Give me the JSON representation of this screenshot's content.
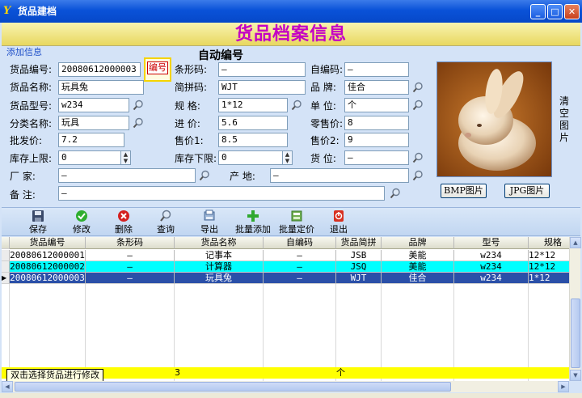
{
  "window": {
    "title": "货品建档",
    "icon": "app-icon"
  },
  "banner": {
    "title": "货品档案信息"
  },
  "section": {
    "add_info": "添加信息",
    "auto_code_label": "自动编号"
  },
  "form": {
    "code_label": "货品编号:",
    "code_value": "20080612000003",
    "code_button": "编号",
    "barcode_label": "条形码:",
    "barcode_value": "—",
    "selfcode_label": "自编码:",
    "selfcode_value": "—",
    "name_label": "货品名称:",
    "name_value": "玩具兔",
    "pinyin_label": "简拼码:",
    "pinyin_value": "WJT",
    "brand_label": "品  牌:",
    "brand_value": "佳合",
    "model_label": "货品型号:",
    "model_value": "w234",
    "spec_label": "规  格:",
    "spec_value": "1*12",
    "unit_label": "单  位:",
    "unit_value": "个",
    "category_label": "分类名称:",
    "category_value": "玩具",
    "purchase_label": "进  价:",
    "purchase_value": "5.6",
    "retail_label": "零售价:",
    "retail_value": "8",
    "wholesale_label": "批发价:",
    "wholesale_value": "7.2",
    "sale1_label": "售价1:",
    "sale1_value": "8.5",
    "sale2_label": "售价2:",
    "sale2_value": "9",
    "stock_max_label": "库存上限:",
    "stock_max_value": "0",
    "stock_min_label": "库存下限:",
    "stock_min_value": "0",
    "shelf_label": "货  位:",
    "shelf_value": "—",
    "vendor_label": "厂  家:",
    "vendor_value": "—",
    "origin_label": "产  地:",
    "origin_value": "—",
    "remark_label": "备  注:",
    "remark_value": "—"
  },
  "image": {
    "clear_label": "清空图片",
    "bmp_button": "BMP图片",
    "jpg_button": "JPG图片"
  },
  "toolbar": {
    "save": "保存",
    "modify": "修改",
    "delete": "删除",
    "query": "查询",
    "export": "导出",
    "batch_add": "批量添加",
    "batch_price": "批量定价",
    "exit": "退出"
  },
  "grid": {
    "columns": [
      "货品编号",
      "条形码",
      "货品名称",
      "自编码",
      "货品简拼",
      "品牌",
      "型号",
      "规格"
    ],
    "rows": [
      [
        "20080612000001",
        "—",
        "记事本",
        "—",
        "JSB",
        "美能",
        "w234",
        "12*12"
      ],
      [
        "20080612000002",
        "—",
        "计算器",
        "—",
        "JSQ",
        "美能",
        "w234",
        "12*12"
      ],
      [
        "20080612000003",
        "—",
        "玩具兔",
        "—",
        "WJT",
        "佳合",
        "w234",
        "1*12"
      ]
    ],
    "footer_count": "3",
    "footer_unit": "个",
    "tooltip": "双击选择货品进行修改"
  },
  "colors": {
    "banner_text": "#c400c4",
    "row_selected": "#00ffff",
    "row_active": "#2a4fa8",
    "footer": "#ffff00"
  }
}
